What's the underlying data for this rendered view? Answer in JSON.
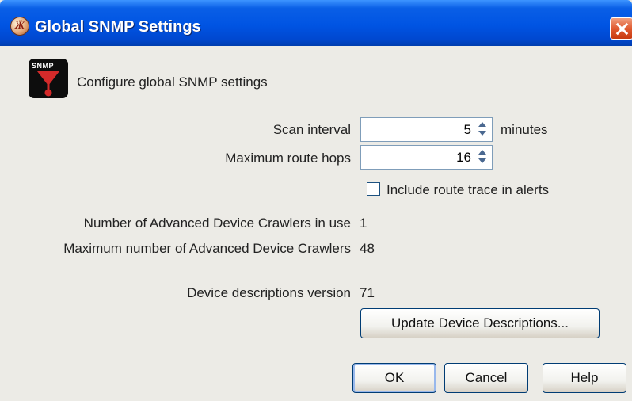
{
  "window": {
    "title": "Global SNMP Settings",
    "app_icon_glyph": "Ӝ",
    "titlebar_color": "#0054e3",
    "close_color": "#e05a30"
  },
  "header": {
    "icon_label": "SNMP",
    "text": "Configure global SNMP settings"
  },
  "form": {
    "scan_interval_label": "Scan interval",
    "scan_interval_value": "5",
    "scan_interval_unit": "minutes",
    "max_hops_label": "Maximum route hops",
    "max_hops_value": "16",
    "include_trace_label": "Include route trace in alerts",
    "include_trace_checked": false
  },
  "info": {
    "crawlers_in_use_label": "Number of Advanced Device Crawlers in use",
    "crawlers_in_use_value": "1",
    "max_crawlers_label": "Maximum number of Advanced Device Crawlers",
    "max_crawlers_value": "48",
    "descriptions_version_label": "Device descriptions version",
    "descriptions_version_value": "71"
  },
  "buttons": {
    "update": "Update Device Descriptions...",
    "ok": "OK",
    "cancel": "Cancel",
    "help": "Help"
  }
}
